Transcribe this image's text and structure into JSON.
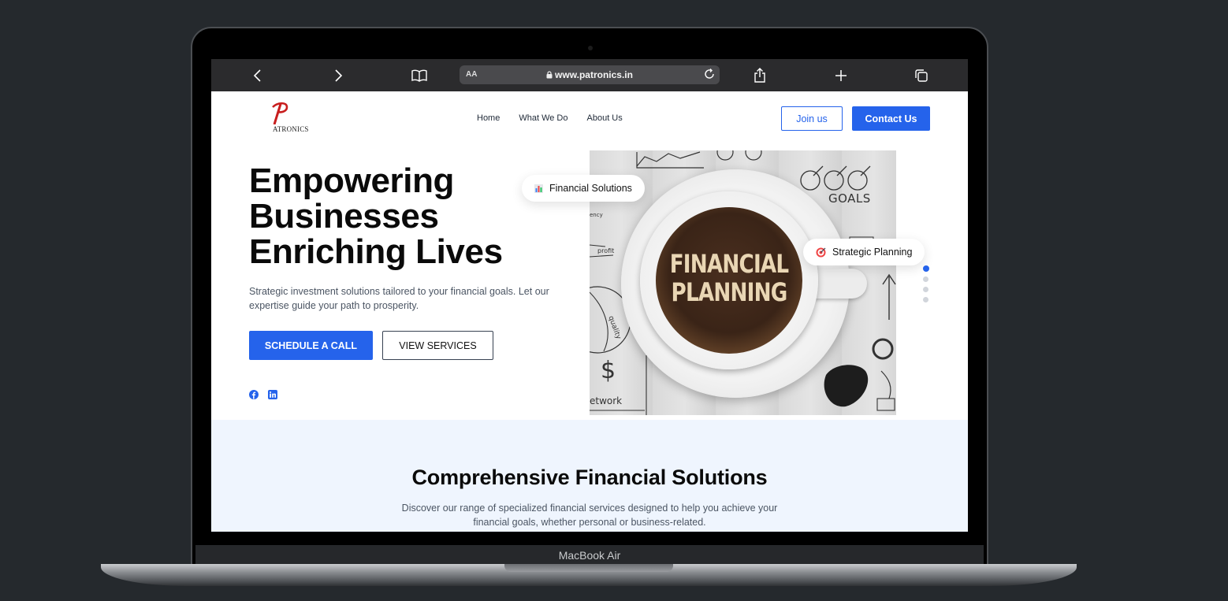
{
  "device": {
    "model_label": "MacBook Air"
  },
  "browser": {
    "url": "www.patronics.in",
    "text_size_label": "AA"
  },
  "site": {
    "logo_text": "ATRONICS",
    "nav": [
      {
        "label": "Home"
      },
      {
        "label": "What We Do"
      },
      {
        "label": "About Us"
      }
    ],
    "join_label": "Join us",
    "contact_label": "Contact Us"
  },
  "hero": {
    "title_lines": [
      "Empowering",
      "Businesses",
      "Enriching Lives"
    ],
    "subtitle": "Strategic investment solutions tailored to your financial goals. Let our expertise guide your path to prosperity.",
    "primary_cta": "SCHEDULE A CALL",
    "secondary_cta": "VIEW SERVICES",
    "image_text_line1": "FINANCIAL",
    "image_text_line2": "PLANNING",
    "image_sketch_goals": "GOALS",
    "image_sketch_network": "etwork",
    "image_sketch_profit": "profit",
    "image_sketch_quality": "quality",
    "image_sketch_ency": "ency",
    "pill_1": "Financial Solutions",
    "pill_2": "Strategic Planning",
    "slides_total": 4,
    "slide_active": 1
  },
  "social": [
    "facebook-icon",
    "linkedin-icon"
  ],
  "solutions": {
    "title": "Comprehensive Financial Solutions",
    "subtitle": "Discover our range of specialized financial services designed to help you achieve your financial goals, whether personal or business-related."
  },
  "colors": {
    "primary": "#2563eb",
    "section_bg": "#eff5fe",
    "background": "#25292d"
  }
}
